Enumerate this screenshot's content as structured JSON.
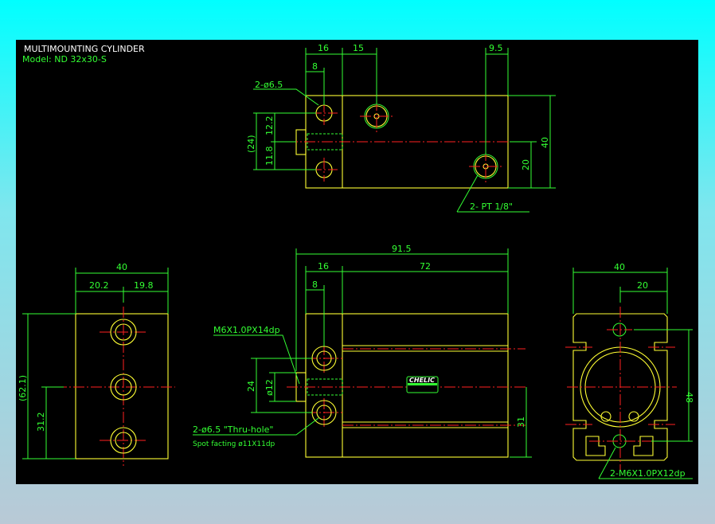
{
  "title": "MULTIMOUNTING CYLINDER",
  "model": "Model: ND 32x30-S",
  "brand": "CHELIC",
  "colors": {
    "background_top": "#00ffff",
    "canvas": "#000000",
    "outline": "#ffff33",
    "dimension": "#33ff33",
    "centerline": "#ff2020"
  },
  "top_view": {
    "dims": {
      "d16": "16",
      "d15": "15",
      "d9_5": "9.5",
      "d8": "8",
      "d12_2": "12.2",
      "d11_8": "11.8",
      "d24": "(24)",
      "d40": "40",
      "d20": "20"
    },
    "notes": {
      "holes": "2-ø6.5",
      "ports": "2- PT 1/8\""
    }
  },
  "side_view": {
    "dims": {
      "d40": "40",
      "d20_2": "20.2",
      "d19_8": "19.8",
      "d62_1": "(62.1)",
      "d31_2": "31.2"
    }
  },
  "front_view": {
    "dims": {
      "d91_5": "91.5",
      "d16": "16",
      "d72": "72",
      "d8": "8",
      "d24": "24",
      "d12": "ø12",
      "d31": "31"
    },
    "notes": {
      "thread": "M6X1.0PX14dp",
      "holes": "2-ø6.5 \"Thru-hole\"",
      "spot": "Spot facting  ø11X11dp"
    }
  },
  "end_view": {
    "dims": {
      "d40": "40",
      "d20": "20",
      "d48": "48"
    },
    "notes": {
      "thread": "2-M6X1.0PX12dp"
    }
  }
}
